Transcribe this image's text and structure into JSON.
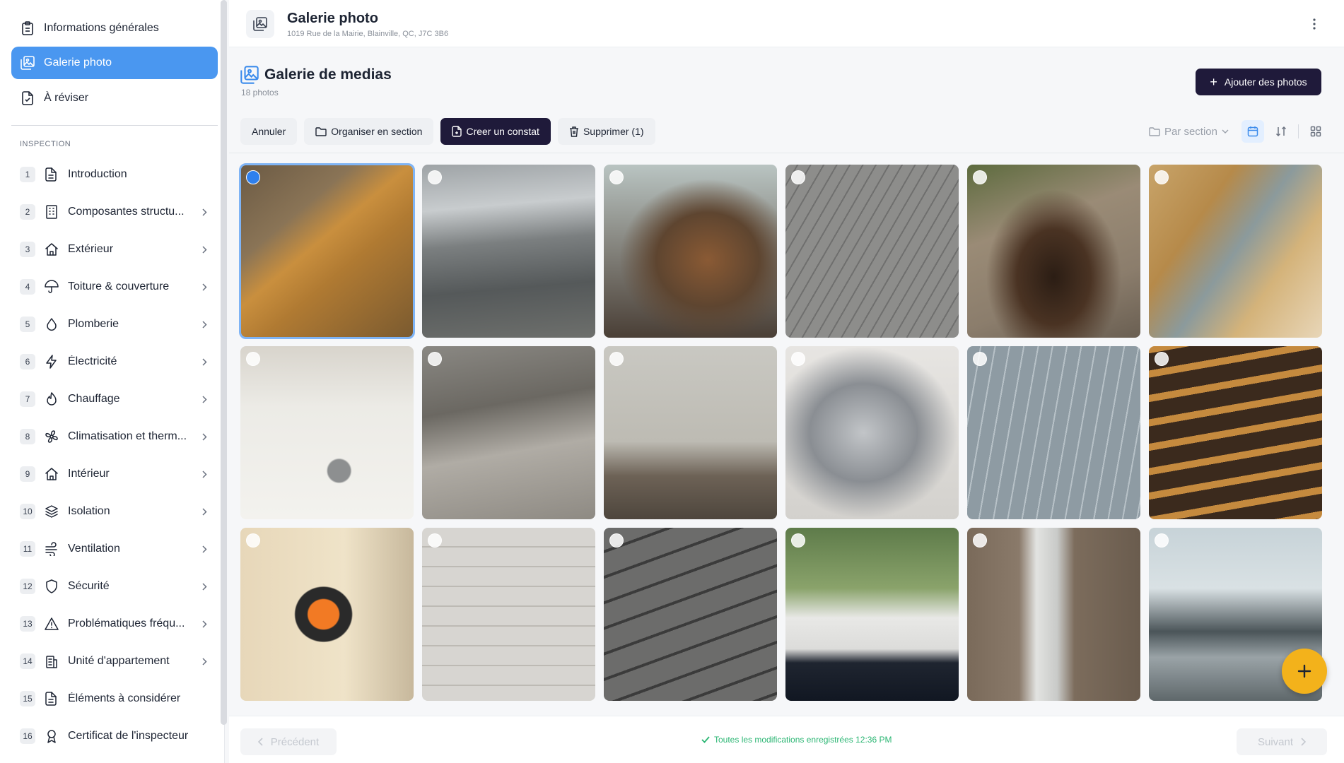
{
  "sidebar": {
    "top_items": [
      {
        "label": "Informations générales",
        "icon": "clipboard-icon"
      },
      {
        "label": "Galerie photo",
        "icon": "gallery-icon",
        "active": true
      },
      {
        "label": "À réviser",
        "icon": "file-review-icon"
      }
    ],
    "section_label": "INSPECTION",
    "items": [
      {
        "num": "1",
        "label": "Introduction",
        "icon": "document-icon",
        "chevron": false
      },
      {
        "num": "2",
        "label": "Composantes structu...",
        "icon": "building-icon",
        "chevron": true
      },
      {
        "num": "3",
        "label": "Extérieur",
        "icon": "home-icon",
        "chevron": true
      },
      {
        "num": "4",
        "label": "Toiture & couverture",
        "icon": "umbrella-icon",
        "chevron": true
      },
      {
        "num": "5",
        "label": "Plomberie",
        "icon": "droplet-icon",
        "chevron": true
      },
      {
        "num": "6",
        "label": "Électricité",
        "icon": "lightning-icon",
        "chevron": true
      },
      {
        "num": "7",
        "label": "Chauffage",
        "icon": "flame-icon",
        "chevron": true
      },
      {
        "num": "8",
        "label": "Climatisation et therm...",
        "icon": "fan-icon",
        "chevron": true
      },
      {
        "num": "9",
        "label": "Intérieur",
        "icon": "home-icon",
        "chevron": true
      },
      {
        "num": "10",
        "label": "Isolation",
        "icon": "layers-icon",
        "chevron": true
      },
      {
        "num": "11",
        "label": "Ventilation",
        "icon": "wind-icon",
        "chevron": true
      },
      {
        "num": "12",
        "label": "Sécurité",
        "icon": "shield-icon",
        "chevron": true
      },
      {
        "num": "13",
        "label": "Problématiques fréqu...",
        "icon": "warning-icon",
        "chevron": true
      },
      {
        "num": "14",
        "label": "Unité d'appartement",
        "icon": "apartment-icon",
        "chevron": true
      },
      {
        "num": "15",
        "label": "Éléments à considérer",
        "icon": "document-icon",
        "chevron": false
      },
      {
        "num": "16",
        "label": "Certificat de l'inspecteur",
        "icon": "award-icon",
        "chevron": false
      }
    ]
  },
  "header": {
    "title": "Galerie photo",
    "address": "1019 Rue de la Mairie, Blainville, QC, J7C 3B6"
  },
  "gallery": {
    "title": "Galerie de medias",
    "count": "18 photos",
    "add_button": "Ajouter des photos"
  },
  "toolbar": {
    "cancel": "Annuler",
    "organize": "Organiser en section",
    "create": "Creer un constat",
    "delete": "Supprimer (1)",
    "group_by": "Par section"
  },
  "photos": [
    {
      "subject": "attic-truss-plate",
      "selected": true
    },
    {
      "subject": "crawlspace-duct",
      "selected": false
    },
    {
      "subject": "rusty-pipe",
      "selected": false
    },
    {
      "subject": "roof-ridge-shingles",
      "selected": false
    },
    {
      "subject": "rotted-wood",
      "selected": false
    },
    {
      "subject": "attic-stained-sheathing",
      "selected": false
    },
    {
      "subject": "bathroom-sink",
      "selected": false
    },
    {
      "subject": "crawlspace-debris",
      "selected": false
    },
    {
      "subject": "cracked-foundation",
      "selected": false
    },
    {
      "subject": "faucet-removed",
      "selected": false
    },
    {
      "subject": "metal-roof",
      "selected": false
    },
    {
      "subject": "exposed-ceiling-joists",
      "selected": false
    },
    {
      "subject": "thermal-camera",
      "selected": false
    },
    {
      "subject": "garage-door",
      "selected": false
    },
    {
      "subject": "lifted-shingles",
      "selected": false
    },
    {
      "subject": "window-sill-marks",
      "selected": false
    },
    {
      "subject": "pvc-drain-pipe",
      "selected": false
    },
    {
      "subject": "window-frame",
      "selected": false
    }
  ],
  "footer": {
    "prev": "Précédent",
    "next": "Suivant",
    "status": "Toutes les modifications enregistrées 12:36 PM"
  },
  "colors": {
    "accent": "#4a97f0",
    "dark_button": "#1f1a3a",
    "fab": "#f3b21b",
    "success": "#2bb673"
  }
}
